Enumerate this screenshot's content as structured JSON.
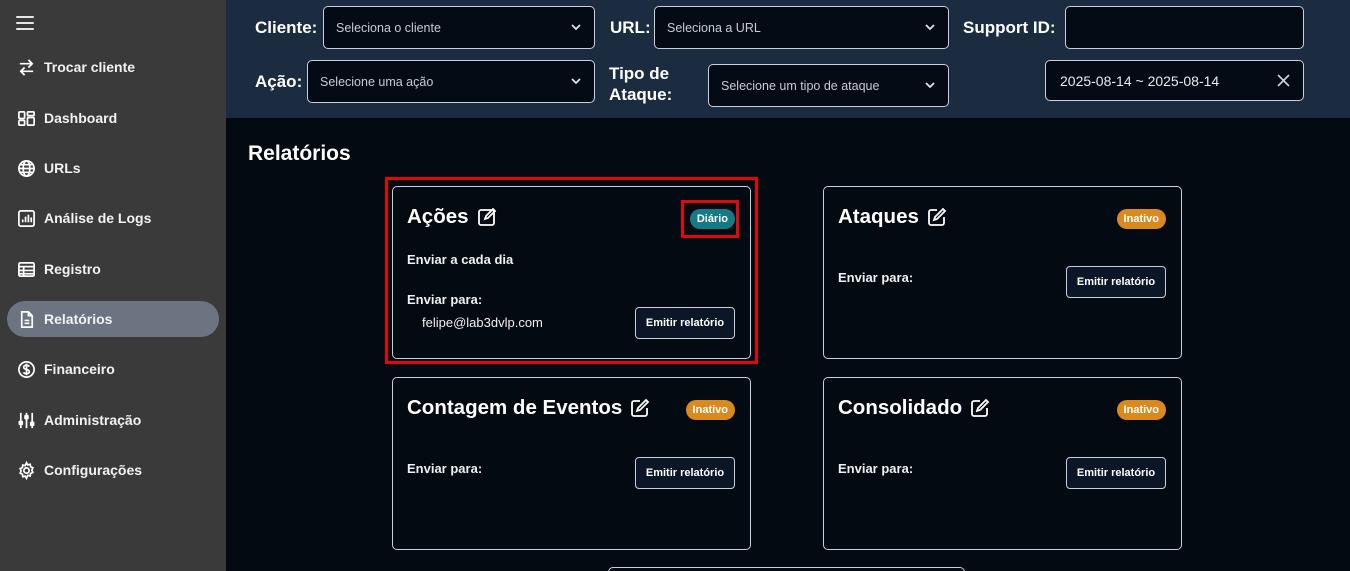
{
  "sidebar": {
    "items": [
      {
        "label": "Trocar cliente",
        "icon": "swap-arrows-icon"
      },
      {
        "label": "Dashboard",
        "icon": "dashboard-icon"
      },
      {
        "label": "URLs",
        "icon": "globe-icon"
      },
      {
        "label": "Análise de Logs",
        "icon": "bar-chart-icon"
      },
      {
        "label": "Registro",
        "icon": "table-icon"
      },
      {
        "label": "Relatórios",
        "icon": "document-icon",
        "active": true
      },
      {
        "label": "Financeiro",
        "icon": "dollar-icon"
      },
      {
        "label": "Administração",
        "icon": "sliders-icon"
      },
      {
        "label": "Configurações",
        "icon": "gear-icon"
      }
    ]
  },
  "filters": {
    "cliente": {
      "label": "Cliente:",
      "placeholder": "Seleciona o cliente"
    },
    "url": {
      "label": "URL:",
      "placeholder": "Seleciona a URL"
    },
    "support_id": {
      "label": "Support ID:",
      "value": ""
    },
    "acao": {
      "label": "Ação:",
      "placeholder": "Selecione uma ação"
    },
    "tipo_ataque": {
      "label_line1": "Tipo de",
      "label_line2": "Ataque:",
      "placeholder": "Selecione um tipo de ataque"
    },
    "date_range": "2025-08-14 ~ 2025-08-14"
  },
  "main": {
    "title": "Relatórios",
    "cards": [
      {
        "title": "Ações",
        "status": "Diário",
        "frequency": "Enviar a cada dia",
        "send_to_label": "Enviar para:",
        "recipient": "felipe@lab3dvlp.com",
        "button": "Emitir relatório"
      },
      {
        "title": "Ataques",
        "status": "Inativo",
        "send_to_label": "Enviar para:",
        "button": "Emitir relatório"
      },
      {
        "title": "Contagem de Eventos",
        "status": "Inativo",
        "send_to_label": "Enviar para:",
        "button": "Emitir relatório"
      },
      {
        "title": "Consolidado",
        "status": "Inativo",
        "send_to_label": "Enviar para:",
        "button": "Emitir relatório"
      }
    ]
  },
  "colors": {
    "sidebar_bg": "#3a3a3a",
    "topbar_bg": "#1b2b40",
    "main_bg": "#040a12",
    "badge_inativo": "#d98a1e",
    "badge_diario": "#137a86",
    "highlight": "#e3070d"
  }
}
